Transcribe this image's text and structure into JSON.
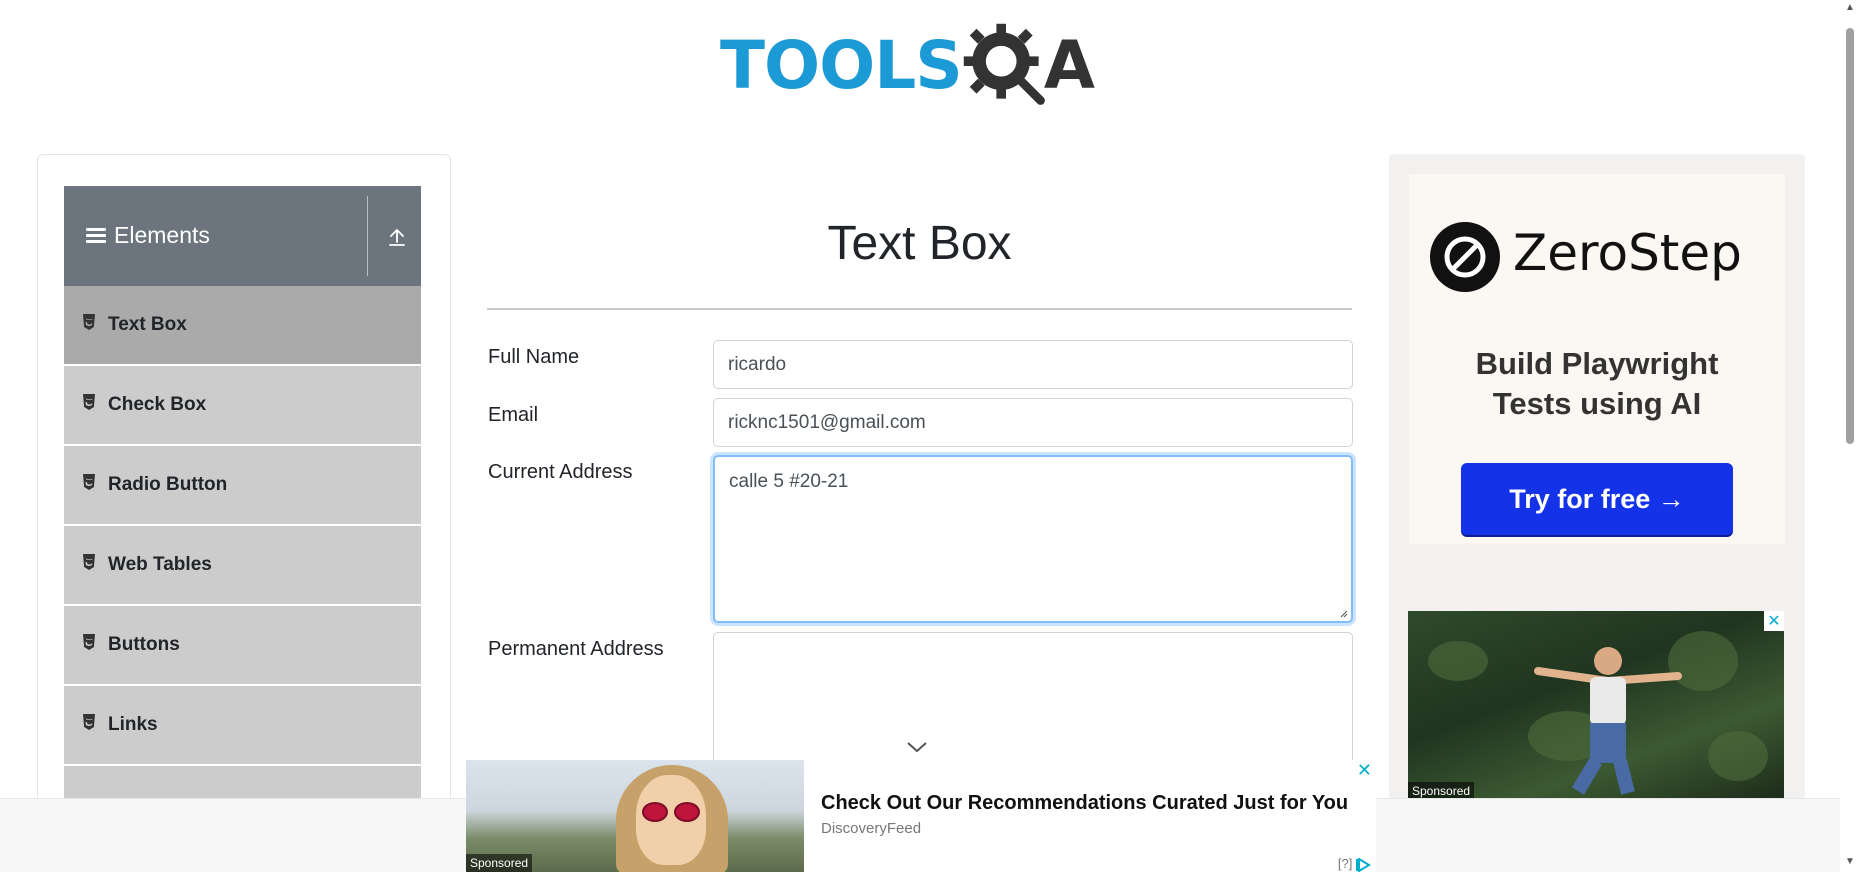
{
  "brand": {
    "logo_main": "TOOLS",
    "logo_tail": "A",
    "logo_color": "#1b9ad6"
  },
  "sidebar": {
    "group_title": "Elements",
    "items": [
      {
        "label": "Text Box",
        "active": true
      },
      {
        "label": "Check Box"
      },
      {
        "label": "Radio Button"
      },
      {
        "label": "Web Tables"
      },
      {
        "label": "Buttons"
      },
      {
        "label": "Links"
      }
    ]
  },
  "main": {
    "title": "Text Box",
    "fields": {
      "full_name": {
        "label": "Full Name",
        "value": "ricardo"
      },
      "email": {
        "label": "Email",
        "value": "ricknc1501@gmail.com"
      },
      "current_address": {
        "label": "Current Address",
        "value": "calle 5 #20-21"
      },
      "permanent_address": {
        "label": "Permanent Address",
        "value": ""
      }
    }
  },
  "ad_right": {
    "brand": "ZeroStep",
    "tagline_1": "Build Playwright",
    "tagline_2": "Tests using AI",
    "cta": "Try for free →",
    "sponsored": "Sponsored",
    "close": "✕"
  },
  "ad_bottom": {
    "headline": "Check Out Our Recommendations Curated Just for You",
    "source": "DiscoveryFeed",
    "sponsored": "Sponsored",
    "close": "✕",
    "adchoices": "[?]"
  }
}
